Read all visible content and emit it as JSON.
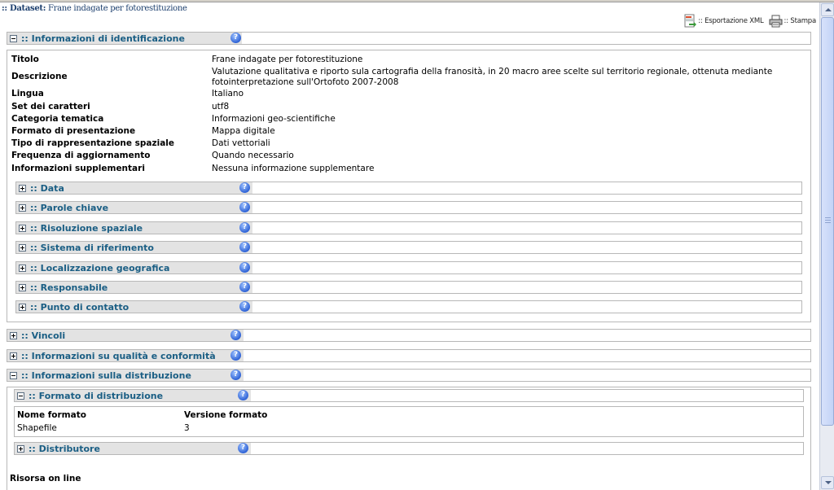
{
  "dataset_title": {
    "prefix": ":: Dataset:",
    "name": "Frane indagate per fotorestituzione"
  },
  "toolbar": {
    "export_label": ":: Esportazione XML",
    "print_label": ":: Stampa"
  },
  "help_glyph": "?",
  "sections": {
    "identificazione": ":: Informazioni di identificazione",
    "data": ":: Data",
    "parole_chiave": ":: Parole chiave",
    "risoluzione": ":: Risoluzione spaziale",
    "sistema": ":: Sistema di riferimento",
    "localizzazione": ":: Localizzazione geografica",
    "responsabile": ":: Responsabile",
    "punto_contatto": ":: Punto di contatto",
    "vincoli": ":: Vincoli",
    "qualita": ":: Informazioni su qualità e conformità",
    "distribuzione": ":: Informazioni sulla distribuzione",
    "formato": ":: Formato di distribuzione",
    "distributore": ":: Distributore"
  },
  "identification": [
    {
      "label": "Titolo",
      "value": "Frane indagate per fotorestituzione"
    },
    {
      "label": "Descrizione",
      "value": "Valutazione qualitativa e riporto sula cartografia della franosità, in 20 macro aree scelte sul territorio regionale, ottenuta mediante fotointerpretazione sull'Ortofoto 2007-2008"
    },
    {
      "label": "Lingua",
      "value": "Italiano"
    },
    {
      "label": "Set dei caratteri",
      "value": "utf8"
    },
    {
      "label": "Categoria tematica",
      "value": "Informazioni geo-scientifiche"
    },
    {
      "label": "Formato di presentazione",
      "value": "Mappa digitale"
    },
    {
      "label": "Tipo di rappresentazione spaziale",
      "value": "Dati vettoriali"
    },
    {
      "label": "Frequenza di aggiornamento",
      "value": "Quando necessario"
    },
    {
      "label": "Informazioni supplementari",
      "value": "Nessuna informazione supplementare"
    }
  ],
  "format_table": {
    "headers": [
      "Nome formato",
      "Versione formato"
    ],
    "row": [
      "Shapefile",
      "3"
    ]
  },
  "risorsa_label": "Risorsa on line"
}
